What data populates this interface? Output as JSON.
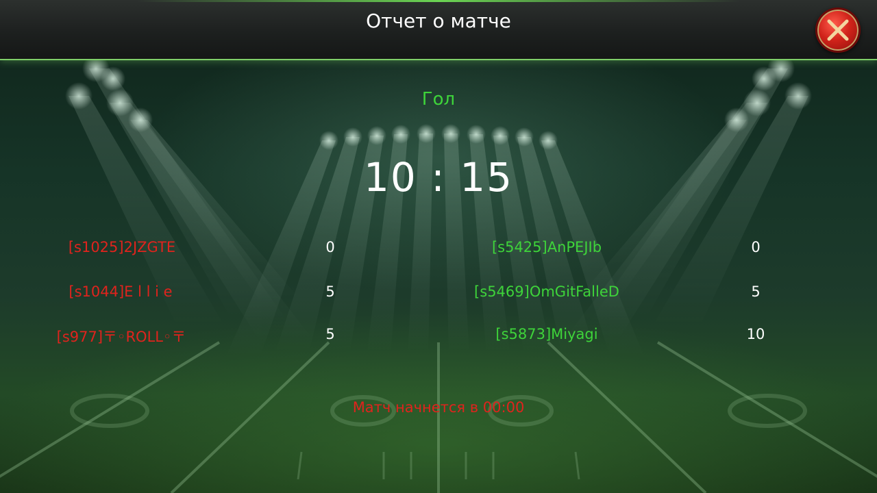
{
  "header": {
    "title": "Отчет о матче",
    "close_icon": "close-icon"
  },
  "goal_label": "Гол",
  "score": "10 : 15",
  "colors": {
    "left_team": "#e0231d",
    "right_team": "#3ed43a",
    "score_text": "#ffffff"
  },
  "left_team": [
    {
      "name": "[s1025]2JZGTE",
      "score": "0"
    },
    {
      "name": "[s1044]E l l i e",
      "score": "5"
    },
    {
      "name": "[s977]〒◦ROLL◦〒",
      "score": "5"
    }
  ],
  "right_team": [
    {
      "name": "[s5425]AnPEJIb",
      "score": "0"
    },
    {
      "name": "[s5469]OmGitFalleD",
      "score": "5"
    },
    {
      "name": "[s5873]Miyagi",
      "score": "10"
    }
  ],
  "match_start": "Матч начнется в 00:00"
}
